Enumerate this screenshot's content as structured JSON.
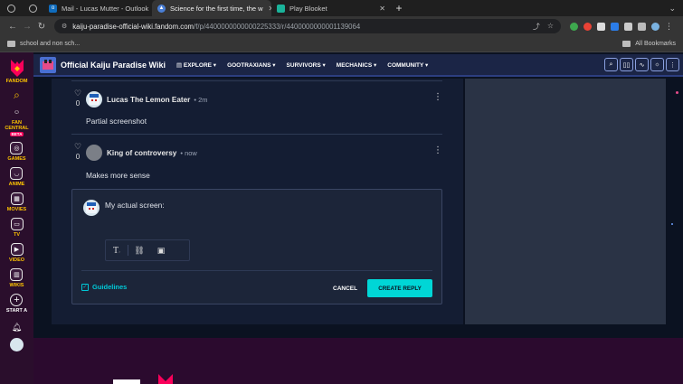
{
  "browser": {
    "tabs": [
      {
        "title": "",
        "active": false
      },
      {
        "title": "",
        "active": false
      },
      {
        "title": "Mail - Lucas Mutter - Outlook",
        "active": false,
        "color": "#0f6cbd"
      },
      {
        "title": "Science for the first time, the w",
        "active": true,
        "color": "#4a7fd6"
      },
      {
        "title": "Play Blooket",
        "active": false,
        "color": "#1ab39a"
      }
    ],
    "new_tab": "+",
    "address": {
      "host": "kaiju-paradise-official-wiki.fandom.com",
      "path": "/f/p/4400000000000225333/r/4400000000001139064"
    },
    "bookmarks": {
      "folder": "school and non sch...",
      "all": "All Bookmarks"
    }
  },
  "rail": {
    "items": [
      {
        "label": "FANDOM"
      },
      {
        "label": ""
      },
      {
        "label": "FAN CENTRAL",
        "badge": "BETA"
      },
      {
        "label": "GAMES"
      },
      {
        "label": "ANIME"
      },
      {
        "label": "MOVIES"
      },
      {
        "label": "TV"
      },
      {
        "label": "VIDEO"
      },
      {
        "label": "WIKIS"
      },
      {
        "label": "START A"
      }
    ]
  },
  "wiki": {
    "title": "Official Kaiju Paradise Wiki",
    "nav": [
      "EXPLORE",
      "GOOTRAXIANS",
      "SURVIVORS",
      "MECHANICS",
      "COMMUNITY"
    ]
  },
  "posts": [
    {
      "author": "Lucas The Lemon Eater",
      "time": "2m",
      "votes": "0",
      "text": "Partial screenshot"
    },
    {
      "author": "King of controversy",
      "time": "now",
      "votes": "0",
      "text": "Makes more sense"
    }
  ],
  "reply": {
    "text": "My actual screen:",
    "guidelines": "Guidelines",
    "cancel": "CANCEL",
    "create": "CREATE REPLY"
  },
  "colors": {
    "accent": "#00d6d6",
    "rail": "#2a0e2c",
    "header": "#1b2546",
    "rail_label": "#ffc500"
  }
}
